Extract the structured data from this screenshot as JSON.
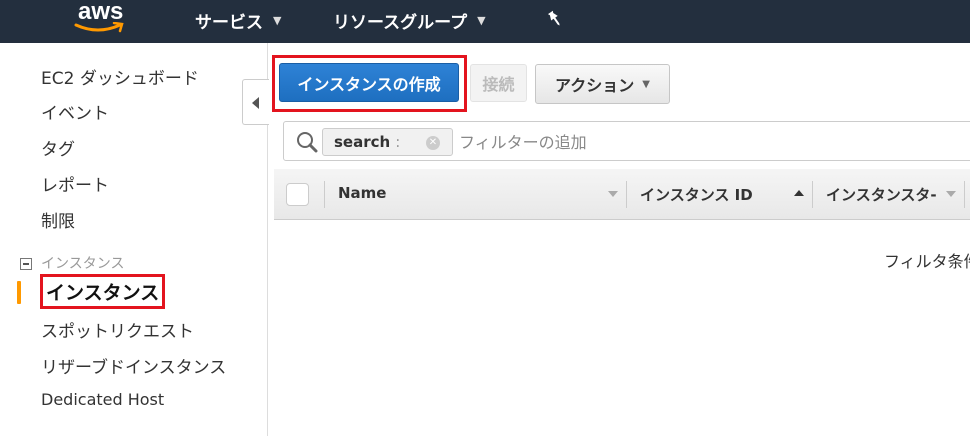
{
  "topbar": {
    "logo": "aws",
    "services_label": "サービス",
    "resource_groups_label": "リソースグループ",
    "caret_icon": "chevron-down-icon",
    "pin_icon": "pin-icon"
  },
  "sidebar": {
    "items": [
      {
        "label": "EC2 ダッシュボード"
      },
      {
        "label": "イベント"
      },
      {
        "label": "タグ"
      },
      {
        "label": "レポート"
      },
      {
        "label": "制限"
      }
    ],
    "group_label": "インスタンス",
    "active_item": "インスタンス",
    "sub_items": [
      {
        "label": "スポットリクエスト"
      },
      {
        "label": "リザーブドインスタンス"
      },
      {
        "label": "Dedicated Host"
      }
    ]
  },
  "toolbar": {
    "create_label": "インスタンスの作成",
    "connect_label": "接続",
    "actions_label": "アクション"
  },
  "filter": {
    "token_key": "search",
    "token_sep": ":",
    "placeholder": "フィルターの追加"
  },
  "table": {
    "columns": [
      {
        "label": "Name"
      },
      {
        "label": "インスタンス ID"
      },
      {
        "label": "インスタンスタ-"
      }
    ],
    "empty_message": "フィルタ条件"
  },
  "colors": {
    "nav_bg": "#232f3e",
    "primary": "#1e6fc0",
    "highlight": "#e3141e",
    "active_bar": "#ff9900"
  }
}
